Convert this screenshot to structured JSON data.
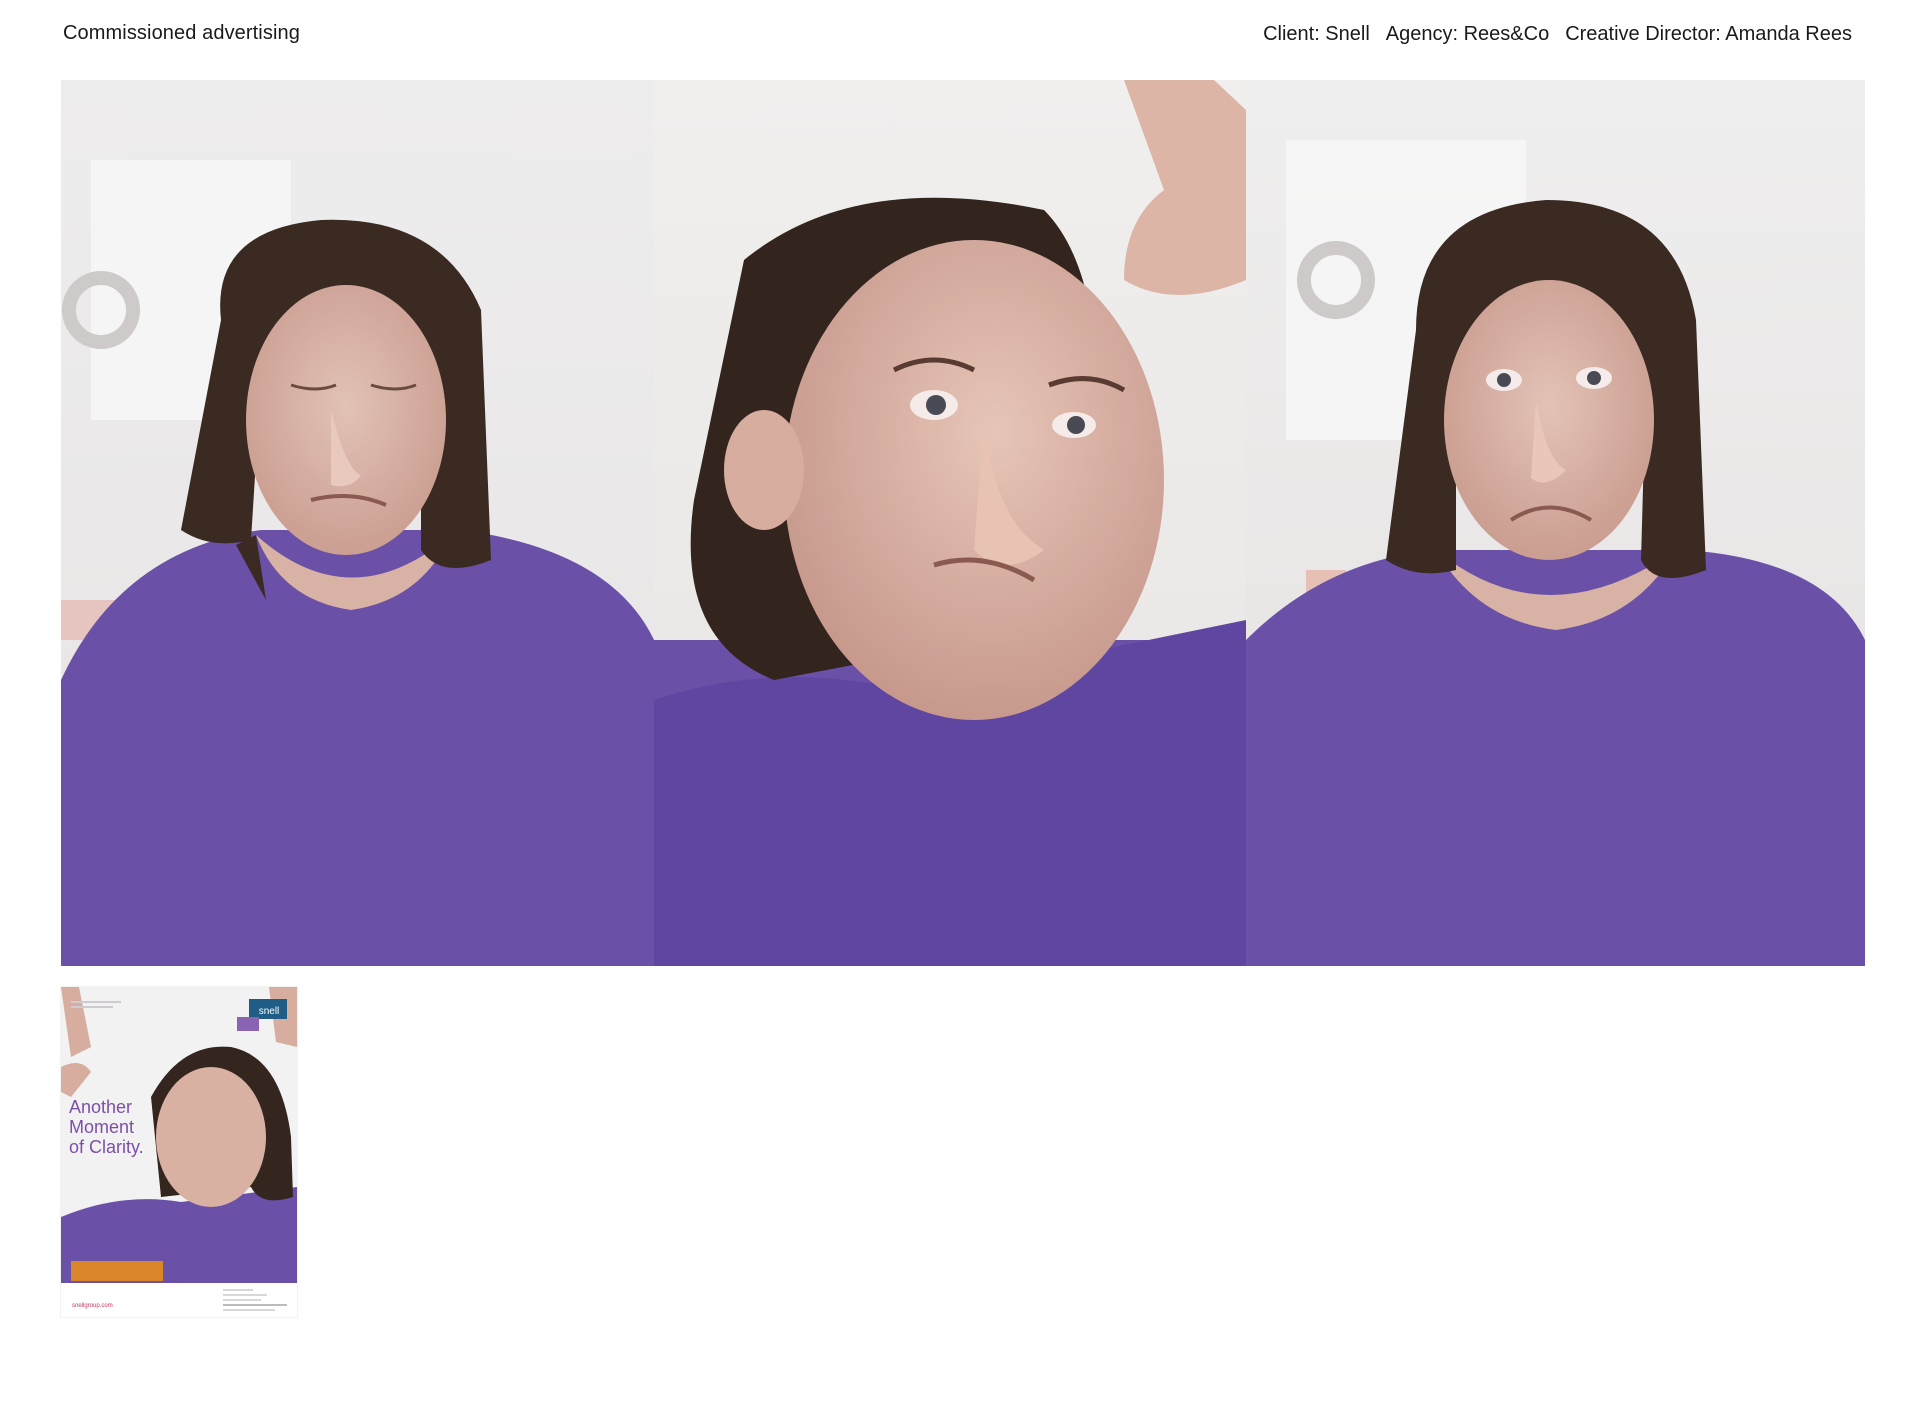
{
  "header": {
    "section_title": "Commissioned advertising",
    "credits": {
      "client": "Client: Snell",
      "agency": "Agency: Rees&Co",
      "creative_director": "Creative Director: Amanda Rees"
    }
  },
  "gallery": {
    "photos": [
      {
        "expression": "eyes closed, pursed lips"
      },
      {
        "expression": "close-up, skeptical look"
      },
      {
        "expression": "frown, wide eyes"
      }
    ]
  },
  "thumbnail": {
    "headline": [
      "Another",
      "Moment",
      "of Clarity."
    ],
    "logo_text": "snell",
    "url": "snellgroup.com"
  },
  "colors": {
    "shirt_purple": "#6a4fa6",
    "brand_purple": "#7d4fa8",
    "brand_orange": "#d9862a",
    "brand_blue": "#1f5c86"
  }
}
